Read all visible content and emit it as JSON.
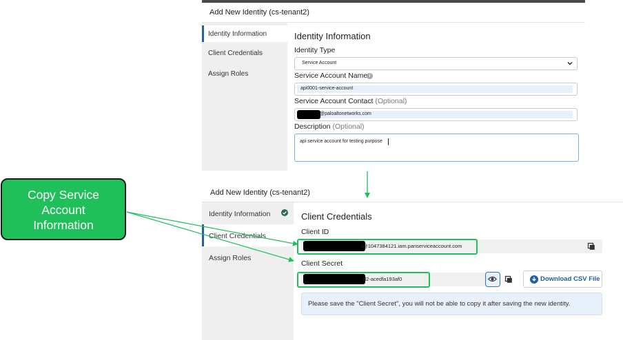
{
  "top_panel": {
    "title": "Add New Identity (cs-tenant2)",
    "sidebar": [
      {
        "label": "Identity Information",
        "active": true
      },
      {
        "label": "Client Credentials",
        "active": false
      },
      {
        "label": "Assign Roles",
        "active": false
      }
    ],
    "section_title": "Identity Information",
    "identity_type": {
      "label": "Identity Type",
      "value": "Service Account"
    },
    "service_account_name": {
      "label": "Service Account Name",
      "value": "api0001-service-account",
      "info_icon": "info-icon"
    },
    "service_account_contact": {
      "label": "Service Account Contact",
      "optional": "(Optional)",
      "value_visible": "@paloaltonetworks.com"
    },
    "description": {
      "label": "Description",
      "optional": "(Optional)",
      "value": "api service account for testing purpose"
    }
  },
  "bottom_panel": {
    "title": "Add New Identity (cs-tenant2)",
    "sidebar": [
      {
        "label": "Identity Information",
        "completed": true,
        "icon": "check-circle-icon"
      },
      {
        "label": "Client Credentials",
        "active": true
      },
      {
        "label": "Assign Roles"
      }
    ],
    "section_title": "Client Credentials",
    "client_id": {
      "label": "Client ID",
      "value_visible": "t@1047384121.iam.panserviceaccount.com"
    },
    "client_secret": {
      "label": "Client Secret",
      "value_visible": "d2-acedfa193af0"
    },
    "download_button": "Download CSV File",
    "notice": "Please save the \"Client Secret\", you will not be able to copy it after saving the new identity."
  },
  "callout": {
    "lines": [
      "Copy Service",
      "Account",
      "Information"
    ]
  },
  "colors": {
    "accent_green": "#1fbf5a",
    "brand_blue": "#1f5ea8",
    "notice_bg": "#e8f1fb"
  }
}
